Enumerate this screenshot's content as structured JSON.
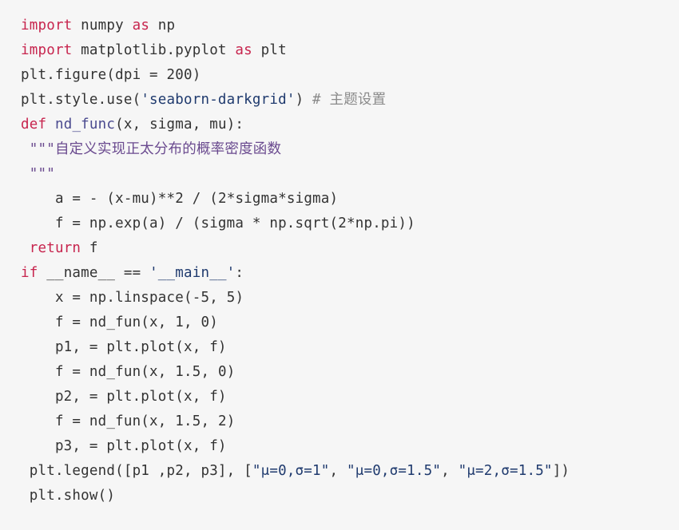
{
  "editor": {
    "language": "Python",
    "background_color": "#f6f6f6",
    "default_text_color": "#333333",
    "keyword_color": "#c7254e",
    "function_name_color": "#4a4a8f",
    "string_color": "#1f3a6e",
    "docstring_color": "#6a4a8f",
    "comment_color": "#8a8a8a",
    "line_count": 21
  },
  "code": {
    "lines": [
      {
        "index": 1,
        "text": "import numpy as np",
        "tokens": [
          {
            "t": "import",
            "k": "kw"
          },
          {
            "t": " numpy ",
            "k": "plain"
          },
          {
            "t": "as",
            "k": "kw"
          },
          {
            "t": " np",
            "k": "plain"
          }
        ]
      },
      {
        "index": 2,
        "text": "import matplotlib.pyplot as plt",
        "tokens": [
          {
            "t": "import",
            "k": "kw"
          },
          {
            "t": " matplotlib.pyplot ",
            "k": "plain"
          },
          {
            "t": "as",
            "k": "kw"
          },
          {
            "t": " plt",
            "k": "plain"
          }
        ]
      },
      {
        "index": 3,
        "text": "plt.figure(dpi = 200)",
        "tokens": [
          {
            "t": "plt.figure(dpi = ",
            "k": "plain"
          },
          {
            "t": "200",
            "k": "num"
          },
          {
            "t": ")",
            "k": "plain"
          }
        ]
      },
      {
        "index": 4,
        "text": "plt.style.use('seaborn-darkgrid') # 主题设置",
        "tokens": [
          {
            "t": "plt.style.use(",
            "k": "plain"
          },
          {
            "t": "'seaborn-darkgrid'",
            "k": "str"
          },
          {
            "t": ") ",
            "k": "plain"
          },
          {
            "t": "# 主题设置",
            "k": "com"
          }
        ]
      },
      {
        "index": 5,
        "text": "def nd_func(x, sigma, mu):",
        "tokens": [
          {
            "t": "def",
            "k": "kw"
          },
          {
            "t": " ",
            "k": "plain"
          },
          {
            "t": "nd_func",
            "k": "fn"
          },
          {
            "t": "(x, sigma, mu):",
            "k": "plain"
          }
        ]
      },
      {
        "index": 6,
        "text": " \"\"\"自定义实现正太分布的概率密度函数",
        "tokens": [
          {
            "t": " ",
            "k": "plain"
          },
          {
            "t": "\"\"\"自定义实现正太分布的概率密度函数",
            "k": "doc"
          }
        ]
      },
      {
        "index": 7,
        "text": " \"\"\"",
        "tokens": [
          {
            "t": " ",
            "k": "plain"
          },
          {
            "t": "\"\"\"",
            "k": "doc"
          }
        ]
      },
      {
        "index": 8,
        "text": "    a = - (x-mu)**2 / (2*sigma*sigma)",
        "tokens": [
          {
            "t": "    a = - (x-mu)**",
            "k": "plain"
          },
          {
            "t": "2",
            "k": "num"
          },
          {
            "t": " / (",
            "k": "plain"
          },
          {
            "t": "2",
            "k": "num"
          },
          {
            "t": "*sigma*sigma)",
            "k": "plain"
          }
        ]
      },
      {
        "index": 9,
        "text": "    f = np.exp(a) / (sigma * np.sqrt(2*np.pi))",
        "tokens": [
          {
            "t": "    f = np.exp(a) / (sigma * np.sqrt(",
            "k": "plain"
          },
          {
            "t": "2",
            "k": "num"
          },
          {
            "t": "*np.pi))",
            "k": "plain"
          }
        ]
      },
      {
        "index": 10,
        "text": " return f",
        "tokens": [
          {
            "t": " ",
            "k": "plain"
          },
          {
            "t": "return",
            "k": "kw"
          },
          {
            "t": " f",
            "k": "plain"
          }
        ]
      },
      {
        "index": 11,
        "text": "if __name__ == '__main__':",
        "tokens": [
          {
            "t": "if",
            "k": "kw"
          },
          {
            "t": " __name__ == ",
            "k": "plain"
          },
          {
            "t": "'__main__'",
            "k": "str"
          },
          {
            "t": ":",
            "k": "plain"
          }
        ]
      },
      {
        "index": 12,
        "text": "    x = np.linspace(-5, 5)",
        "tokens": [
          {
            "t": "    x = np.linspace(-",
            "k": "plain"
          },
          {
            "t": "5",
            "k": "num"
          },
          {
            "t": ", ",
            "k": "plain"
          },
          {
            "t": "5",
            "k": "num"
          },
          {
            "t": ")",
            "k": "plain"
          }
        ]
      },
      {
        "index": 13,
        "text": "    f = nd_fun(x, 1, 0)",
        "tokens": [
          {
            "t": "    f = nd_fun(x, ",
            "k": "plain"
          },
          {
            "t": "1",
            "k": "num"
          },
          {
            "t": ", ",
            "k": "plain"
          },
          {
            "t": "0",
            "k": "num"
          },
          {
            "t": ")",
            "k": "plain"
          }
        ]
      },
      {
        "index": 14,
        "text": "    p1, = plt.plot(x, f)",
        "tokens": [
          {
            "t": "    p1, = plt.plot(x, f)",
            "k": "plain"
          }
        ]
      },
      {
        "index": 15,
        "text": "    f = nd_fun(x, 1.5, 0)",
        "tokens": [
          {
            "t": "    f = nd_fun(x, ",
            "k": "plain"
          },
          {
            "t": "1.5",
            "k": "num"
          },
          {
            "t": ", ",
            "k": "plain"
          },
          {
            "t": "0",
            "k": "num"
          },
          {
            "t": ")",
            "k": "plain"
          }
        ]
      },
      {
        "index": 16,
        "text": "    p2, = plt.plot(x, f)",
        "tokens": [
          {
            "t": "    p2, = plt.plot(x, f)",
            "k": "plain"
          }
        ]
      },
      {
        "index": 17,
        "text": "    f = nd_fun(x, 1.5, 2)",
        "tokens": [
          {
            "t": "    f = nd_fun(x, ",
            "k": "plain"
          },
          {
            "t": "1.5",
            "k": "num"
          },
          {
            "t": ", ",
            "k": "plain"
          },
          {
            "t": "2",
            "k": "num"
          },
          {
            "t": ")",
            "k": "plain"
          }
        ]
      },
      {
        "index": 18,
        "text": "    p3, = plt.plot(x, f)",
        "tokens": [
          {
            "t": "    p3, = plt.plot(x, f)",
            "k": "plain"
          }
        ]
      },
      {
        "index": 19,
        "text": " plt.legend([p1 ,p2, p3], [\"μ=0,σ=1\", \"μ=0,σ=1.5\", \"μ=2,σ=1.5\"])",
        "tokens": [
          {
            "t": " plt.legend([p1 ,p2, p3], [",
            "k": "plain"
          },
          {
            "t": "\"μ=0,σ=1\"",
            "k": "str"
          },
          {
            "t": ", ",
            "k": "plain"
          },
          {
            "t": "\"μ=0,σ=1.5\"",
            "k": "str"
          },
          {
            "t": ", ",
            "k": "plain"
          },
          {
            "t": "\"μ=2,σ=1.5\"",
            "k": "str"
          },
          {
            "t": "])",
            "k": "plain"
          }
        ]
      },
      {
        "index": 20,
        "text": " plt.show()",
        "tokens": [
          {
            "t": " plt.show()",
            "k": "plain"
          }
        ]
      }
    ]
  }
}
